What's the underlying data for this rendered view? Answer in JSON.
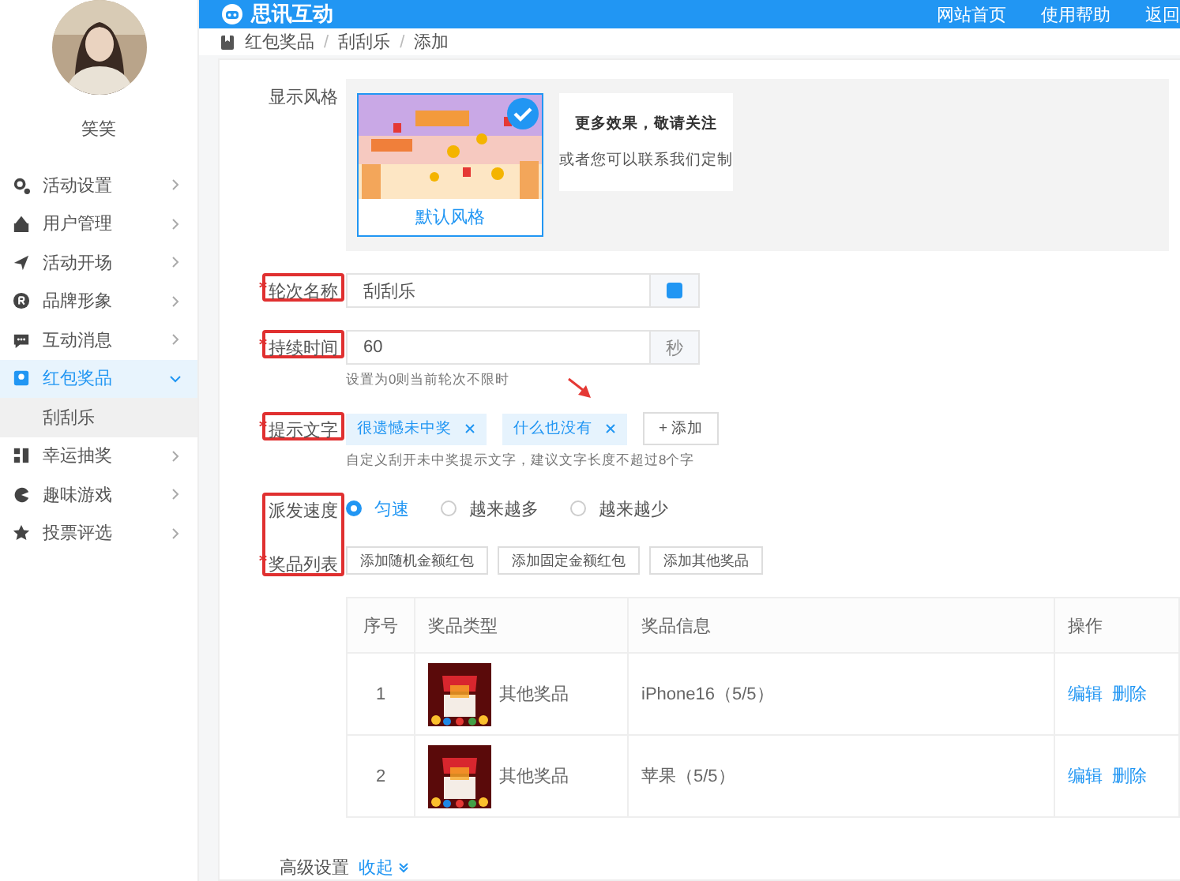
{
  "header": {
    "logo": "思讯互动",
    "links": [
      "网站首页",
      "使用帮助",
      "返回"
    ]
  },
  "sidebar": {
    "user": "笑笑",
    "items": [
      {
        "label": "活动设置",
        "selected": false,
        "expanded": false
      },
      {
        "label": "用户管理",
        "selected": false,
        "expanded": false
      },
      {
        "label": "活动开场",
        "selected": false,
        "expanded": false
      },
      {
        "label": "品牌形象",
        "selected": false,
        "expanded": false
      },
      {
        "label": "互动消息",
        "selected": false,
        "expanded": false
      },
      {
        "label": "红包奖品",
        "selected": true,
        "expanded": true,
        "children": [
          {
            "label": "刮刮乐",
            "selected": true
          }
        ]
      },
      {
        "label": "幸运抽奖",
        "selected": false,
        "expanded": false
      },
      {
        "label": "趣味游戏",
        "selected": false,
        "expanded": false
      },
      {
        "label": "投票评选",
        "selected": false,
        "expanded": false
      }
    ]
  },
  "breadcrumb": {
    "items": [
      "红包奖品",
      "刮刮乐",
      "添加"
    ],
    "separator": "/"
  },
  "form": {
    "style": {
      "label": "显示风格",
      "required": false,
      "annotated": false,
      "options": [
        {
          "name": "默认风格",
          "selected": true
        }
      ],
      "promo_title": "更多效果，敬请关注",
      "promo_text": "或者您可以联系我们定制"
    },
    "round_name": {
      "label": "轮次名称",
      "required": true,
      "annotated": true,
      "value": "刮刮乐",
      "checked": true
    },
    "duration": {
      "label": "持续时间",
      "required": true,
      "annotated": true,
      "value": "60",
      "unit": "秒",
      "hint": "设置为0则当前轮次不限时"
    },
    "prompt": {
      "label": "提示文字",
      "required": true,
      "annotated": true,
      "tags": [
        "很遗憾未中奖",
        "什么也没有"
      ],
      "add": "+ 添加",
      "hint": "自定义刮开未中奖提示文字，建议文字长度不超过8个字"
    },
    "speed": {
      "label": "派发速度",
      "required": false,
      "annotated": true,
      "options": [
        {
          "label": "匀速",
          "selected": true
        },
        {
          "label": "越来越多",
          "selected": false
        },
        {
          "label": "越来越少",
          "selected": false
        }
      ]
    },
    "prizes": {
      "label": "奖品列表",
      "required": true,
      "annotated": true,
      "joins_previous_annotation": true,
      "buttons": [
        "添加随机金额红包",
        "添加固定金额红包",
        "添加其他奖品"
      ],
      "table": {
        "columns": [
          "序号",
          "奖品类型",
          "奖品信息",
          "操作"
        ],
        "rows": [
          {
            "index": "1",
            "type": "其他奖品",
            "info": "iPhone16（5/5）",
            "actions": [
              "编辑",
              "删除"
            ]
          },
          {
            "index": "2",
            "type": "其他奖品",
            "info": "苹果（5/5）",
            "actions": [
              "编辑",
              "删除"
            ]
          }
        ]
      }
    },
    "advanced": {
      "label": "高级设置",
      "toggle": "收起"
    }
  }
}
